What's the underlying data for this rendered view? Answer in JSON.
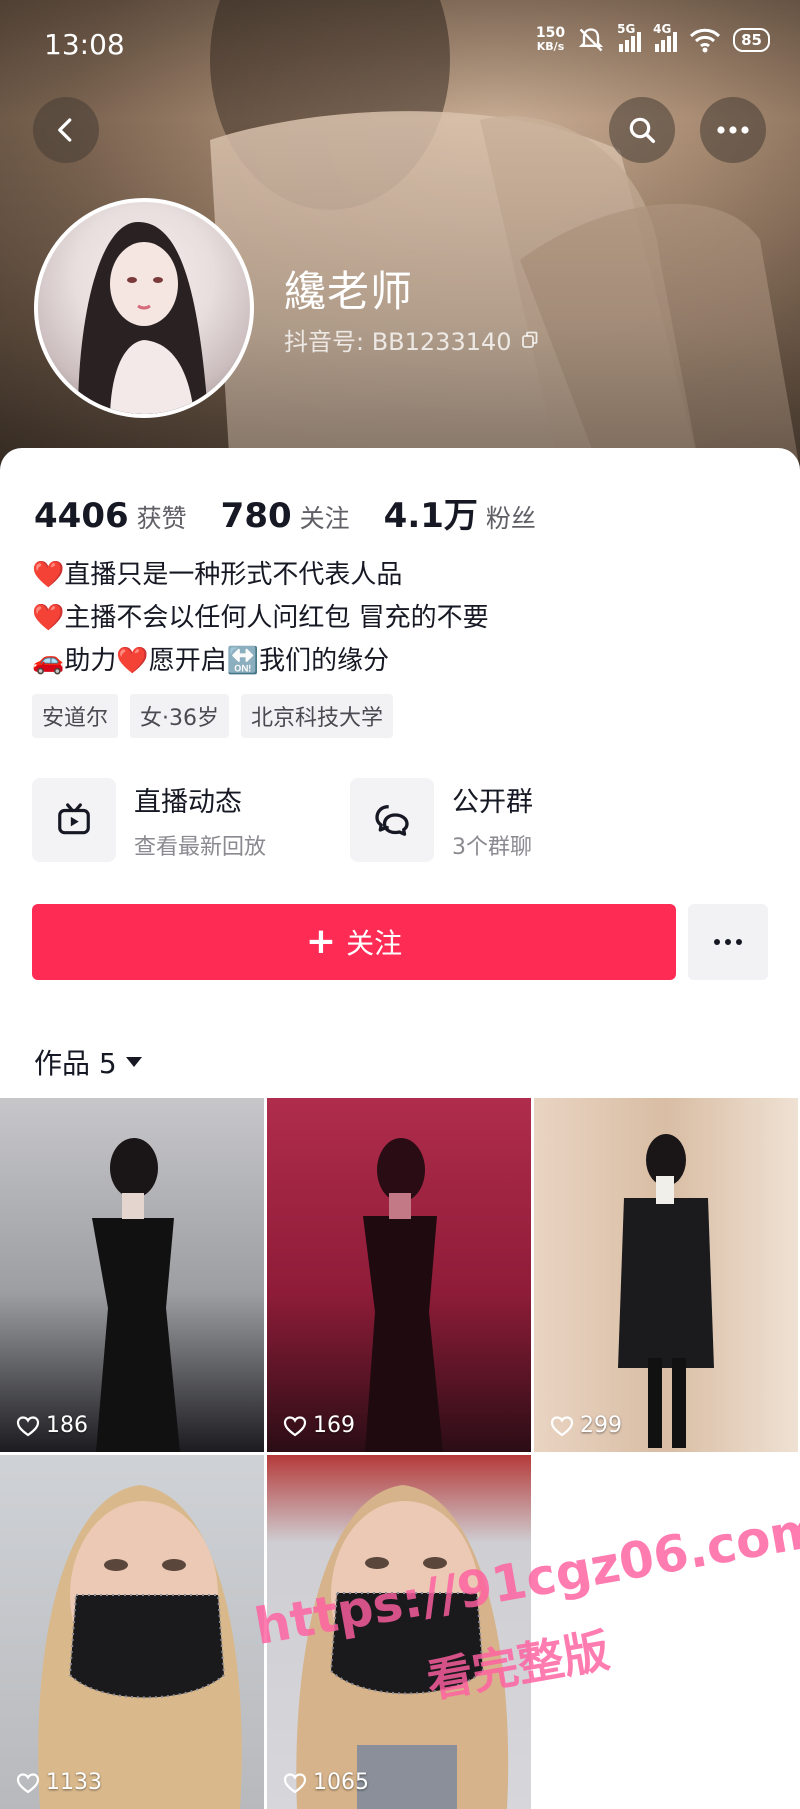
{
  "status_bar": {
    "time": "13:08",
    "net_speed_value": "150",
    "net_speed_unit": "KB/s",
    "sig1_label": "5G",
    "sig2_label": "4G",
    "battery": "85"
  },
  "profile": {
    "nickname": "纔老师",
    "douyin_id": "抖音号: BB1233140"
  },
  "stats": [
    {
      "value": "4406",
      "label": "获赞"
    },
    {
      "value": "780",
      "label": "关注"
    },
    {
      "value": "4.1万",
      "label": "粉丝"
    }
  ],
  "bio": [
    {
      "emoji": "❤️",
      "text": "直播只是一种形式不代表人品"
    },
    {
      "emoji": "❤️",
      "text": "主播不会以任何人问红包 冒充的不要"
    },
    {
      "text": "🚗助力❤️愿开启🔛我们的缘分"
    }
  ],
  "tags": [
    "安道尔",
    "女·36岁",
    "北京科技大学"
  ],
  "entries": {
    "live": {
      "title": "直播动态",
      "subtitle": "查看最新回放"
    },
    "group": {
      "title": "公开群",
      "subtitle": "3个群聊"
    }
  },
  "actions": {
    "follow_label": "关注"
  },
  "works": {
    "tab_label": "作品 5"
  },
  "videos": [
    {
      "likes": "186"
    },
    {
      "likes": "169"
    },
    {
      "likes": "299"
    },
    {
      "likes": "1133"
    },
    {
      "likes": "1065"
    }
  ],
  "watermark": {
    "url": "https://91cgz06.com",
    "subtitle": "看完整版"
  },
  "colors": {
    "accent": "#fe2c55"
  },
  "icons": [
    "back-icon",
    "search-icon",
    "more-icon",
    "tv-icon",
    "chat-icon",
    "copy-icon",
    "heart-icon",
    "dropdown-icon"
  ]
}
